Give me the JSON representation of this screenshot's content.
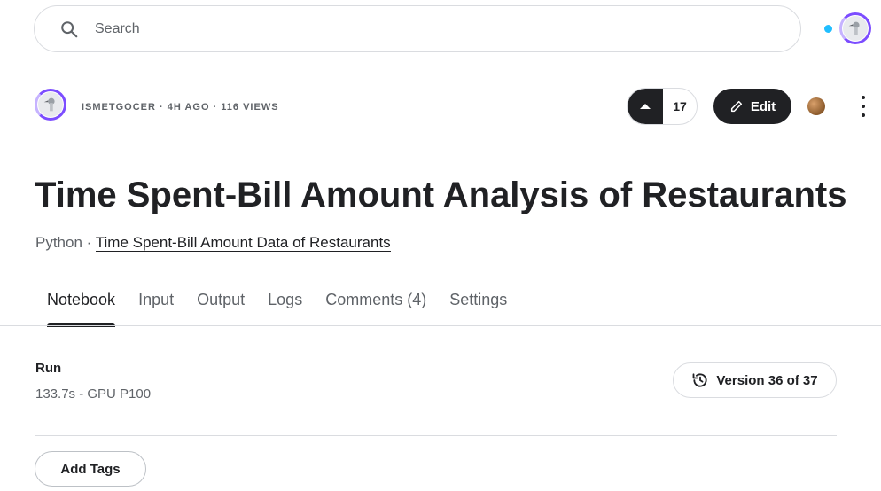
{
  "search": {
    "placeholder": "Search",
    "icon": "search-icon"
  },
  "header": {
    "notification_color": "#20beff",
    "user_avatar": "duck-avatar"
  },
  "notebook": {
    "author": "ISMETGOCER",
    "time_ago": "4H AGO",
    "views": "116 VIEWS",
    "meta_separator": " · ",
    "upvote_count": "17",
    "edit_label": "Edit",
    "medal": "bronze-medal",
    "title": "Time Spent-Bill Amount Analysis of Restaurants",
    "language": "Python",
    "dataset_link": "Time Spent-Bill Amount Data of Restaurants"
  },
  "tabs": [
    {
      "label": "Notebook",
      "active": true
    },
    {
      "label": "Input",
      "active": false
    },
    {
      "label": "Output",
      "active": false
    },
    {
      "label": "Logs",
      "active": false
    },
    {
      "label": "Comments (4)",
      "active": false
    },
    {
      "label": "Settings",
      "active": false
    }
  ],
  "run": {
    "label": "Run",
    "info": "133.7s - GPU P100",
    "version_label": "Version 36 of 37"
  },
  "tags": {
    "add_label": "Add Tags"
  },
  "colors": {
    "primary_dark": "#202124",
    "muted_text": "#5f6368",
    "border": "#dadce0",
    "ring_accent": "#7c4dff"
  }
}
